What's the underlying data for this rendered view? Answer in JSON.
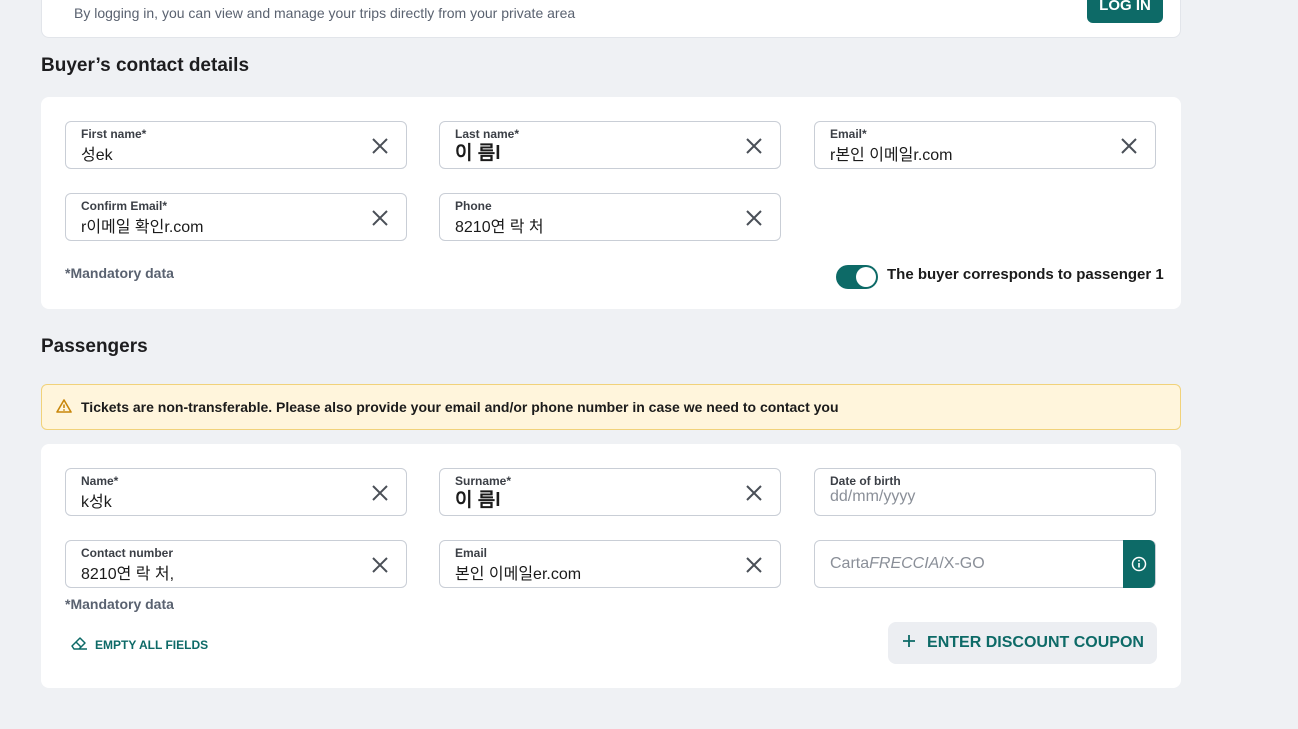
{
  "login": {
    "subtitle": "By logging in, you can view and manage your trips directly from your private area",
    "button": "LOG IN"
  },
  "buyer": {
    "title": "Buyer’s contact details",
    "first_name": {
      "label": "First name*",
      "value": "성ek"
    },
    "last_name": {
      "label": "Last name*",
      "value": "이 름l"
    },
    "email": {
      "label": "Email*",
      "value": "r본인 이메일r.com"
    },
    "confirm_email": {
      "label": "Confirm Email*",
      "value": "r이메일 확인r.com"
    },
    "phone": {
      "label": "Phone",
      "value": "8210연 락 처"
    },
    "mandatory": "*Mandatory data",
    "toggle_label": "The buyer corresponds to passenger 1",
    "toggle_on": true
  },
  "passengers": {
    "title": "Passengers",
    "alert": "Tickets are non-transferable. Please also provide your email and/or phone number in case we need to contact you",
    "name": {
      "label": "Name*",
      "value": "k성k"
    },
    "surname": {
      "label": "Surname*",
      "value": "이 름l"
    },
    "dob": {
      "label": "Date of birth",
      "placeholder": "dd/mm/yyyy"
    },
    "contact": {
      "label": "Contact number",
      "value": "8210연 락 처,"
    },
    "email": {
      "label": "Email",
      "value": "본인 이메일er.com"
    },
    "carta": {
      "prefix": "Carta",
      "brand": "FRECCIA",
      "suffix": "/X-GO"
    },
    "mandatory": "*Mandatory data",
    "empty_all": "EMPTY ALL FIELDS",
    "discount": "ENTER DISCOUNT COUPON"
  },
  "colors": {
    "accent": "#0d6a67",
    "alert_bg": "#fff5dc",
    "page_bg": "#eff1f4"
  }
}
